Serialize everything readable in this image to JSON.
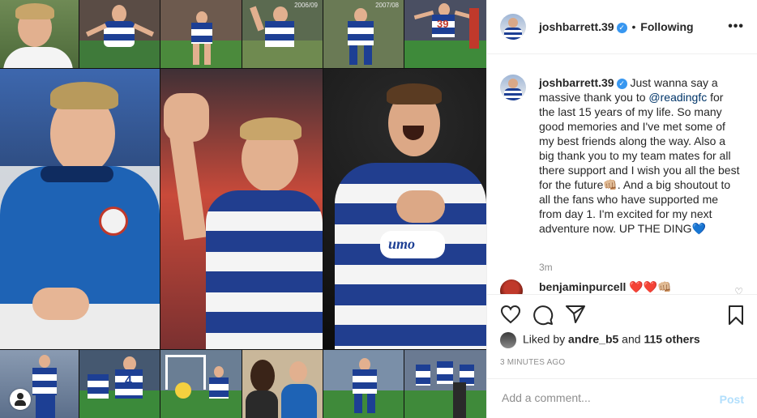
{
  "post": {
    "username": "joshbarrett.39",
    "verified_glyph": "✓",
    "separator": "•",
    "follow_state": "Following",
    "more_label": "•••",
    "caption": {
      "pre": " Just wanna say a massive thank you to ",
      "mention": "@readingfc",
      "post": " for the last 15 years of my life. So many good memories and I've met some of my best friends along the way. Also a big thank you to my team mates for all there support and I wish you all the best for the future👊🏼. And a big shoutout to all the fans who have supported me from day 1. I'm excited for my next adventure now. UP THE DING💙"
    },
    "time_ago": "3m",
    "comment": {
      "username": "benjaminpurcell",
      "text": " ❤️❤️👊🏼"
    },
    "likes": {
      "prefix": "Liked by ",
      "user": "andre_b5",
      "middle": " and ",
      "others": "115 others"
    },
    "posted": "3 MINUTES AGO",
    "add_comment_placeholder": "Add a comment...",
    "post_button": "Post"
  },
  "media": {
    "year_labels": [
      "2006/09",
      "2007/08"
    ],
    "shirt_numbers": [
      "39",
      "4"
    ]
  },
  "icons": {
    "like": "heart-icon",
    "comment": "comment-bubble-icon",
    "share": "paper-plane-icon",
    "save": "bookmark-icon",
    "account": "account-circle-icon",
    "verified": "verified-badge-icon",
    "more": "more-options-icon"
  },
  "colors": {
    "accent": "#3897f0",
    "mention": "#003569",
    "muted": "#8e8e8e",
    "post_disabled": "#b2dffc",
    "reading_blue": "#1d3f94"
  }
}
